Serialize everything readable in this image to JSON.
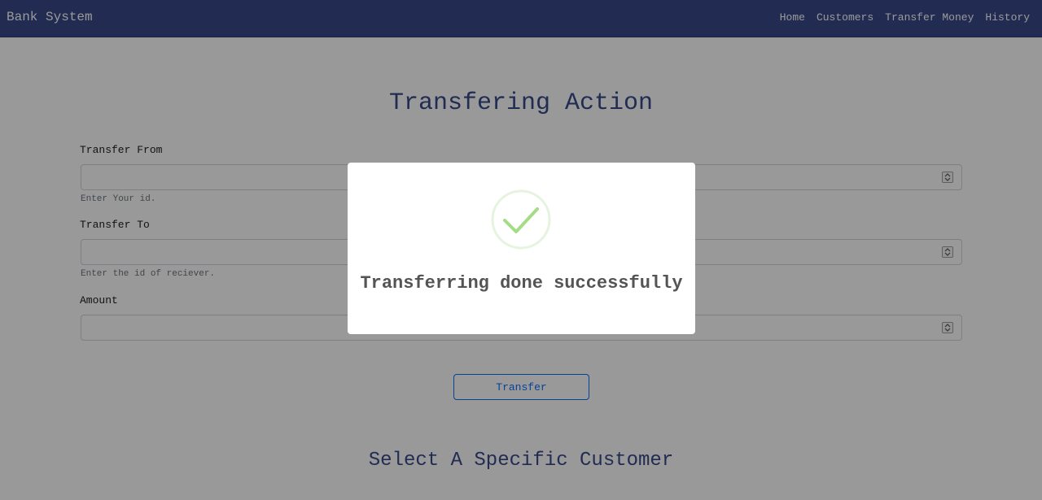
{
  "navbar": {
    "brand": "Bank System",
    "links": [
      "Home",
      "Customers",
      "Transfer Money",
      "History"
    ]
  },
  "main": {
    "title": "Transfering Action",
    "fields": [
      {
        "label": "Transfer From",
        "value": "",
        "hint": "Enter Your id."
      },
      {
        "label": "Transfer To",
        "value": "",
        "hint": "Enter the id of reciever."
      },
      {
        "label": "Amount",
        "value": "",
        "hint": ""
      }
    ],
    "transfer_button": "Transfer",
    "subtitle": "Select A Specific Customer"
  },
  "modal": {
    "icon": "success-check-icon",
    "message": "Transferring done successfully"
  },
  "colors": {
    "navbar": "#3a4a8a",
    "accent": "#0d6efd",
    "success": "#a5dc86"
  }
}
